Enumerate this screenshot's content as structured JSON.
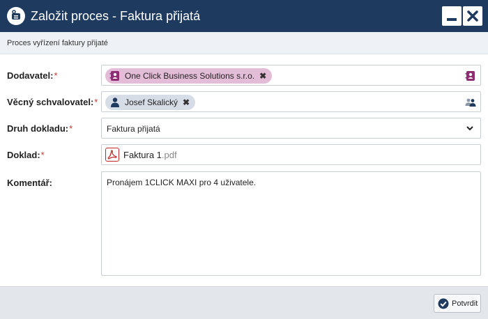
{
  "window": {
    "title": "Založit proces - Faktura přijatá",
    "app_icon": "process-icon",
    "controls": [
      "minimize-icon",
      "close-icon"
    ]
  },
  "subtitle": "Proces vyřízení faktury přijaté",
  "form": {
    "supplier": {
      "label": "Dodavatel:",
      "required_mark": "*",
      "value": "One Click Business Solutions s.r.o.",
      "chip_icon": "contact-card-icon",
      "picker_icon": "contact-card-icon",
      "chip_color": "#e3bcd7"
    },
    "approver": {
      "label": "Věcný schvalovatel:",
      "required_mark": "*",
      "value": "Josef Skalický",
      "chip_icon": "user-icon",
      "picker_icon": "users-icon",
      "chip_color": "#d7dde6"
    },
    "doc_type": {
      "label": "Druh dokladu:",
      "required_mark": "*",
      "value": "Faktura přijatá"
    },
    "document": {
      "label": "Doklad:",
      "required_mark": "*",
      "file_name": "Faktura 1",
      "file_ext": ".pdf",
      "icon": "pdf-icon"
    },
    "comment": {
      "label": "Komentář:",
      "value": "Pronájem 1CLICK MAXI pro 4 uživatele."
    }
  },
  "footer": {
    "confirm_label": "Potvrdit",
    "confirm_icon": "check-circle-icon"
  },
  "colors": {
    "titlebar": "#1e3a5f",
    "required": "#c0392b",
    "supplier_chip": "#e3bcd7",
    "approver_chip": "#d7dde6",
    "pdf": "#c62828"
  }
}
